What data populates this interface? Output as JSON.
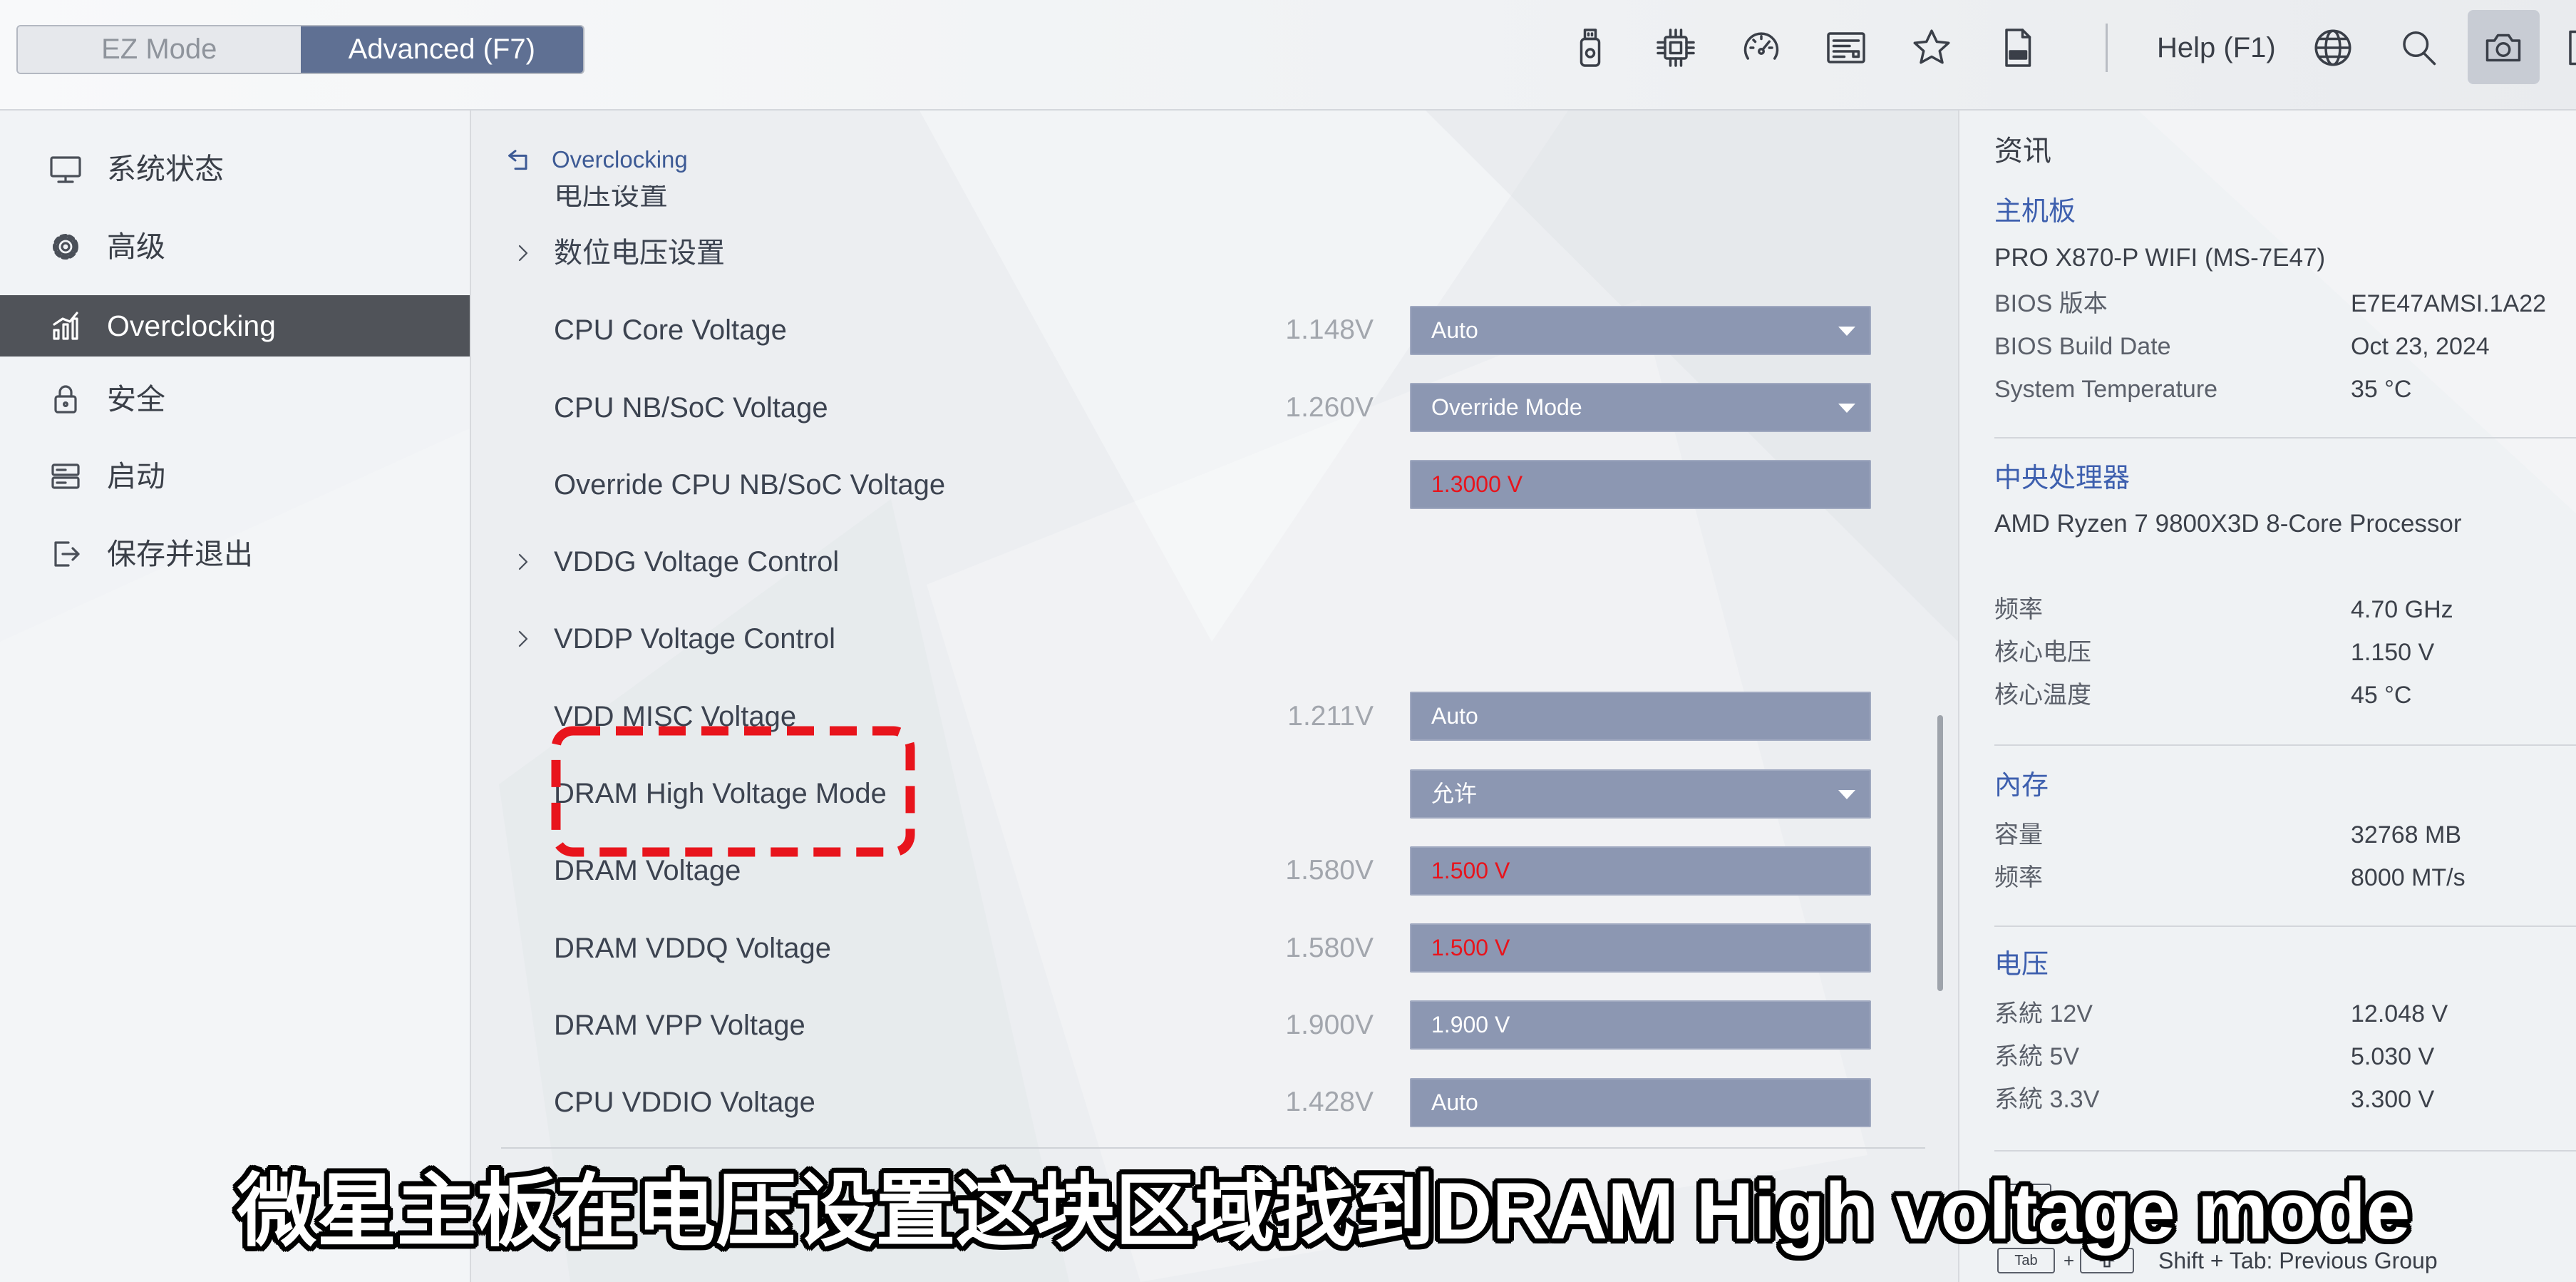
{
  "topbar": {
    "mode_tabs": [
      {
        "label": "EZ Mode"
      },
      {
        "label": "Advanced (F7)"
      }
    ],
    "active_tab_index": 1,
    "left_icons": [
      "usb-flash-icon",
      "cpu-icon",
      "gauge-icon",
      "bios-info-icon",
      "star-icon",
      "log-file-icon"
    ],
    "help_label": "Help (F1)",
    "right_icons": [
      "globe-icon",
      "search-icon",
      "camera-icon"
    ]
  },
  "sidebar": {
    "selected_index": 2,
    "items": [
      {
        "label": "系统状态",
        "icon": "monitor-icon"
      },
      {
        "label": "高级",
        "icon": "gear-icon"
      },
      {
        "label": "Overclocking",
        "icon": "bar-chart-icon"
      },
      {
        "label": "安全",
        "icon": "lock-icon"
      },
      {
        "label": "启动",
        "icon": "boot-drive-icon"
      },
      {
        "label": "保存并退出",
        "icon": "exit-icon"
      }
    ]
  },
  "main": {
    "breadcrumb": "Overclocking",
    "section_header": "电压设置",
    "rows": [
      {
        "label": "数位电压设置",
        "expandable": true
      },
      {
        "label": "CPU Core Voltage",
        "reading": "1.148V",
        "control": {
          "type": "dropdown",
          "value": "Auto",
          "text_color": "#ffffff"
        }
      },
      {
        "label": "CPU NB/SoC Voltage",
        "reading": "1.260V",
        "control": {
          "type": "dropdown",
          "value": "Override Mode",
          "text_color": "#ffffff"
        }
      },
      {
        "label": "Override CPU NB/SoC Voltage",
        "control": {
          "type": "input",
          "value": "1.3000 V",
          "text_color": "#e8141c"
        }
      },
      {
        "label": "VDDG Voltage Control",
        "expandable": true
      },
      {
        "label": "VDDP Voltage Control",
        "expandable": true
      },
      {
        "label": "VDD MISC Voltage",
        "reading": "1.211V",
        "control": {
          "type": "input",
          "value": "Auto",
          "text_color": "#ffffff"
        }
      },
      {
        "label": "DRAM High Voltage Mode",
        "control": {
          "type": "dropdown",
          "value": "允许",
          "text_color": "#ffffff"
        }
      },
      {
        "label": "DRAM Voltage",
        "reading": "1.580V",
        "control": {
          "type": "input",
          "value": "1.500 V",
          "text_color": "#e8141c"
        }
      },
      {
        "label": "DRAM VDDQ Voltage",
        "reading": "1.580V",
        "control": {
          "type": "input",
          "value": "1.500 V",
          "text_color": "#e8141c"
        }
      },
      {
        "label": "DRAM VPP Voltage",
        "reading": "1.900V",
        "control": {
          "type": "input",
          "value": "1.900 V",
          "text_color": "#ffffff"
        }
      },
      {
        "label": "CPU VDDIO Voltage",
        "reading": "1.428V",
        "control": {
          "type": "input",
          "value": "Auto",
          "text_color": "#ffffff"
        }
      }
    ]
  },
  "info": {
    "title": "资讯",
    "sections": [
      {
        "heading": "主机板",
        "name": "PRO X870-P WIFI (MS-7E47)",
        "rows": [
          {
            "label": "BIOS 版本",
            "value": "E7E47AMSI.1A22"
          },
          {
            "label": "BIOS Build Date",
            "value": "Oct 23, 2024"
          },
          {
            "label": "System Temperature",
            "value": "35 °C"
          }
        ]
      },
      {
        "heading": "中央处理器",
        "name": "AMD Ryzen 7 9800X3D 8-Core Processor",
        "rows": [
          {
            "label": "频率",
            "value": "4.70 GHz"
          },
          {
            "label": "核心电压",
            "value": "1.150 V"
          },
          {
            "label": "核心温度",
            "value": "45 °C"
          }
        ]
      },
      {
        "heading": "內存",
        "rows": [
          {
            "label": "容量",
            "value": "32768 MB"
          },
          {
            "label": "频率",
            "value": "8000 MT/s"
          }
        ]
      },
      {
        "heading": "电压",
        "rows": [
          {
            "label": "系統 12V",
            "value": "12.048 V"
          },
          {
            "label": "系統 5V",
            "value": "5.030 V"
          },
          {
            "label": "系統 3.3V",
            "value": "3.300 V"
          }
        ]
      }
    ]
  },
  "footer_hint": {
    "key": "Tab",
    "joiner": "+",
    "key2_icon": "shift-key-icon",
    "text": "Shift + Tab: Previous Group"
  },
  "subtitle": "微星主板在电压设置这块区域找到DRAM High voltage mode",
  "colors": {
    "accent": "#5f7093",
    "control_bg": "#8c97b2",
    "modified_value": "#e8141c",
    "heading_blue": "#3d5fae",
    "annotation_red": "#e8141c",
    "sidebar_selected": "#505359"
  }
}
